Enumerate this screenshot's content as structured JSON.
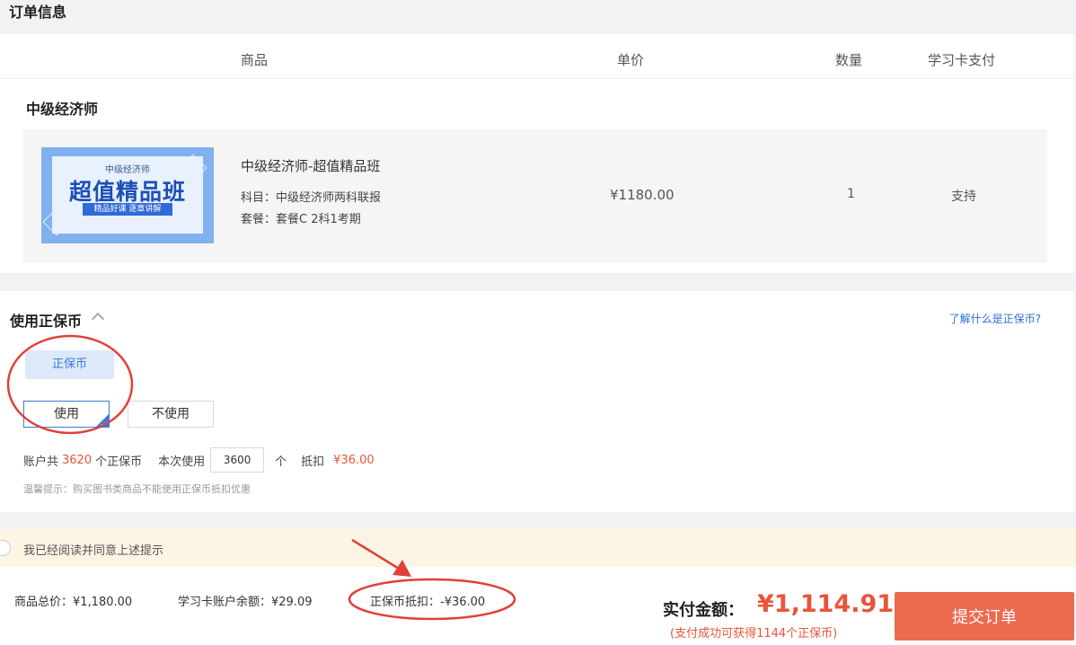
{
  "page_title": "订单信息",
  "table_headers": {
    "product": "商品",
    "unit_price": "单价",
    "quantity": "数量",
    "study_card": "学习卡支付"
  },
  "category": "中级经济师",
  "item": {
    "thumb_small": "中级经济师",
    "thumb_title": "超值精品班",
    "thumb_tag": "精品好课 逐章讲解",
    "name": "中级经济师-超值精品班",
    "subject": "科目：中级经济师两科联报",
    "package": "套餐：套餐C 2科1考期",
    "price": "¥1180.00",
    "quantity": "1",
    "study_card_support": "支持"
  },
  "coin_section": {
    "title": "使用正保币",
    "learn_link": "了解什么是正保币?",
    "tag": "正保币",
    "use_label": "使用",
    "not_use_label": "不使用",
    "selected": "use",
    "balance_prefix": "账户共",
    "balance": "3620",
    "balance_suffix": "个正保币",
    "use_prefix": "本次使用",
    "use_value": "3600",
    "use_unit": "个",
    "deduct_label": "抵扣",
    "deduct_value": "¥36.00",
    "tip": "温馨提示：购买图书类商品不能使用正保币抵扣优惠"
  },
  "agree": {
    "text": "我已经阅读并同意上述提示",
    "checked": false
  },
  "summary": {
    "total": "商品总价：¥1,180.00",
    "card_balance": "学习卡账户余额：¥29.09",
    "coin_deduct": "正保币抵扣：-¥36.00",
    "pay_label": "实付金额：",
    "pay_amount": "¥1,114.91",
    "earn_note": "(支付成功可获得1144个正保币)",
    "submit_label": "提交订单"
  },
  "colors": {
    "accent_red": "#e8553a",
    "accent_blue": "#3a7ad8",
    "annotation_red": "#e0403a",
    "submit_bg": "#ec6a4f"
  }
}
